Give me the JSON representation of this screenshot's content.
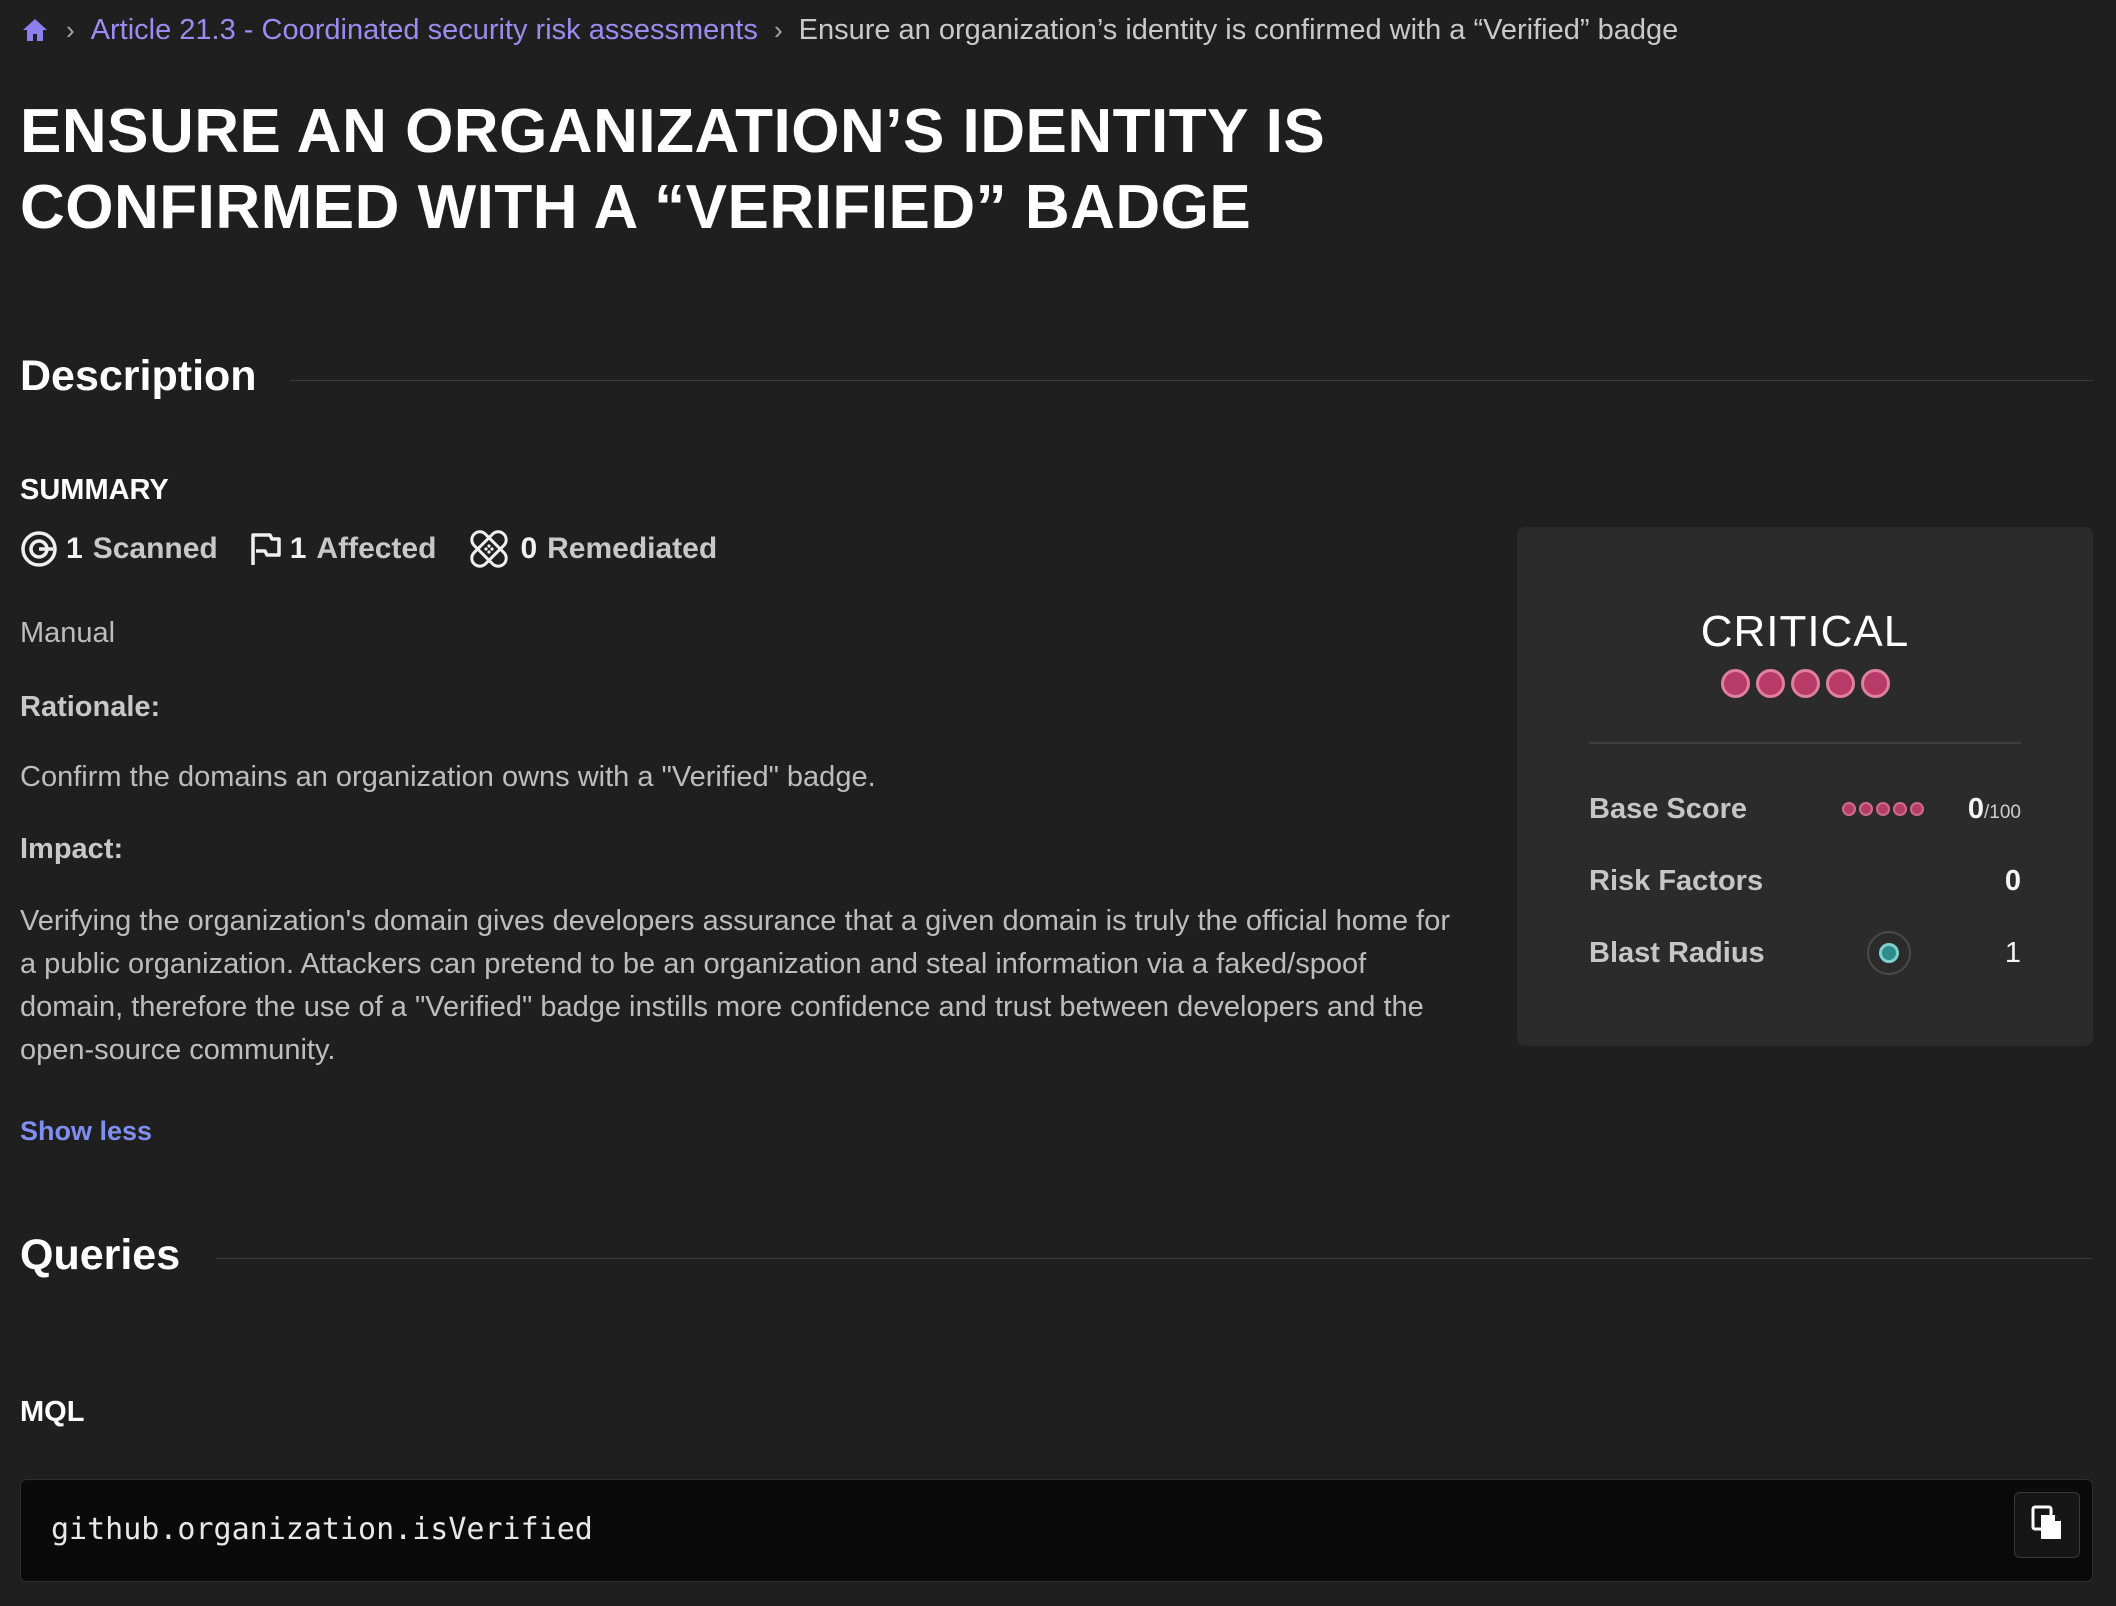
{
  "breadcrumb": {
    "home_icon": "home-icon",
    "parent": "Article 21.3 - Coordinated security risk assessments",
    "current": "Ensure an organization’s identity is confirmed with a “Verified” badge",
    "separator": "›"
  },
  "page": {
    "title": "ENSURE AN ORGANIZATION’S IDENTITY IS CONFIRMED WITH A “VERIFIED” BADGE"
  },
  "description": {
    "heading": "Description",
    "summary_label": "SUMMARY",
    "stats": {
      "scanned": {
        "count": "1",
        "label": "Scanned",
        "icon": "target-icon"
      },
      "affected": {
        "count": "1",
        "label": "Affected",
        "icon": "flag-icon"
      },
      "remediated": {
        "count": "0",
        "label": "Remediated",
        "icon": "bandage-icon"
      }
    },
    "type": "Manual",
    "rationale_label": "Rationale:",
    "rationale_text": "Confirm the domains an organization owns with a \"Verified\" badge.",
    "impact_label": "Impact:",
    "impact_text": "Verifying the organization's domain gives developers assurance that a given domain is truly the official home for a public organization. Attackers can pretend to be an organization and steal information via a faked/spoof domain, therefore the use of a \"Verified\" badge instills more confidence and trust between developers and the open-source community.",
    "show_less": "Show less"
  },
  "severity": {
    "level": "CRITICAL",
    "level_dots": 5,
    "base_score_label": "Base Score",
    "base_score_value": "0",
    "base_score_max": "/100",
    "risk_factors_label": "Risk Factors",
    "risk_factors_value": "0",
    "blast_radius_label": "Blast Radius",
    "blast_radius_value": "1",
    "accent_color": "#b83a66"
  },
  "queries": {
    "heading": "Queries",
    "mql_label": "MQL",
    "code": "github.organization.isVerified",
    "copy_icon": "copy-icon"
  }
}
